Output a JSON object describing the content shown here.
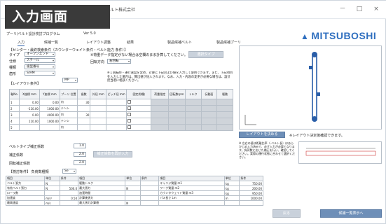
{
  "banner": "入力画面",
  "window": {
    "title": "ベルト株式会社",
    "controls": [
      "－",
      "□",
      "×"
    ]
  },
  "app": {
    "title": "プーリ/ベルト設計検討プログラム",
    "version": "Ver 5.0"
  },
  "logo": {
    "text": "MITSUBOSHI",
    "icon": "triangle-logo-icon",
    "color": "#2f6fbf"
  },
  "tabs": [
    "入力",
    "候補一覧",
    "レイアウト調整",
    "結果",
    "製品候補ベルト",
    "製品候補プーリ"
  ],
  "section_center": "【センター・最終検索条件（カウンターウェイト条件・ベルト能力 条件）】",
  "form": {
    "type_label": "タイプ",
    "type_value": "オープンエンド",
    "drive_label": "仕様",
    "drive_value": "スチール",
    "kind_label": "種類",
    "kind_value": "歯型番号",
    "pitch_label": "歯形",
    "pitch_value": "S/HM",
    "pitch_sub": "MP",
    "note_top": "※荷重データ指定がない場合は空欄のまま計算してください。",
    "rotation_label": "回転方向",
    "rotation_value": "右回転",
    "calc_button": "選択タイプ",
    "note_block": "※１回転時・運行速度を含め、計算に下記および値を入力して使用できます。また、下記項目を入力した場合は、算出値が記入されます。なお、入力・内容の変更が必要な場合は、設計担当者に相談ください。"
  },
  "layout_section": "【レイアウト条件】",
  "grid": {
    "headers": [
      "軸No.",
      "X座標\nmm",
      "Y座標\nmm",
      "プーリ\n位置",
      "歯数",
      "外径\nmm",
      "ピッチ径\nmm",
      "固定/移動\n",
      "荷重指定",
      "回転数rpm",
      "トルク",
      "伝動面\n",
      "駆動\n"
    ],
    "rows": [
      [
        "1",
        "0.00",
        "0.00",
        "内",
        "30"
      ],
      [
        "2",
        "-110.00",
        "1000.00",
        "テンシ",
        ""
      ],
      [
        "3",
        "0.00",
        "4000.00",
        "内",
        "30"
      ],
      [
        "4",
        "110.00",
        "1000.00",
        "テンシ",
        ""
      ],
      [
        "5",
        "",
        "",
        "内",
        ""
      ]
    ]
  },
  "params": {
    "belt_label": "ベルトタイプ補正係数",
    "belt_value": "1.0",
    "load_label": "補正係数",
    "load_value": "2.0",
    "cond_label": "回転補正係数",
    "cond_value": "2.0",
    "cond_button": "補正係数を再計入力",
    "calc_label": "【検討条件】 負荷数種類",
    "calc_value": "Se"
  },
  "canvas": {
    "layout_button": "レイアウトを決める",
    "layout_note": "※レイアウト決定後確認できます。",
    "legend_note": "※ 左右の値は距離比率（-ベルト長）はあらかじめ入力済みで、必ず入力が必要となります。負荷数に応じた補正を行い、確認してください。実際の運行状態に合わせて選択ください。",
    "preview_label": "プレビュー"
  },
  "results": {
    "headers": [
      "項目",
      "単位",
      "条件",
      "項目",
      "単位",
      "条件",
      "項目",
      "単位",
      "条件"
    ],
    "rows": [
      [
        "ベルト張力",
        "N",
        "",
        "駆動トルク",
        "",
        "",
        "キャリジ質量 m1",
        "kg",
        "750.00"
      ],
      [
        "有効ベルト張力",
        "N",
        "500.0",
        "最大張力",
        "N",
        "",
        "ワーク質量 m2",
        "kg",
        "200.00"
      ],
      [
        "ローラ数",
        "",
        "",
        "加速時間",
        "",
        "",
        "カウンタウェイト質量 m3",
        "kg",
        "950.00"
      ],
      [
        "加速度",
        "m/s²",
        "0.50",
        "計算後張力",
        "",
        "",
        "パス長さ Lm",
        "m",
        "1000.00"
      ],
      [
        "最高速度",
        "m/s",
        "",
        "最大張力計算値",
        "N",
        "",
        "",
        "",
        ""
      ]
    ]
  },
  "footer": {
    "back_button": "戻る",
    "next_button": "候補一覧表示へ"
  },
  "colors": {
    "accent": "#2f6fbf",
    "banner_bg": "#3a3a3a",
    "grid_gray": "#cfd4da"
  }
}
